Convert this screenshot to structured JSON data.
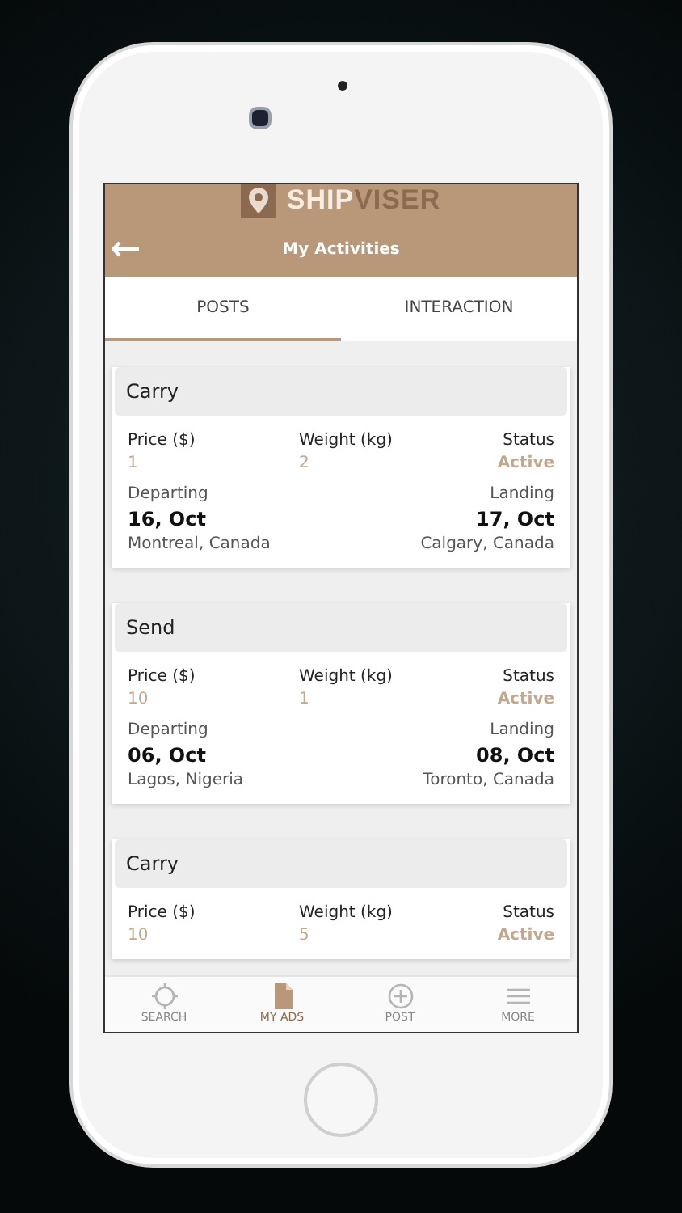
{
  "logo": {
    "parts": [
      "SHIP",
      "VISER"
    ]
  },
  "header": {
    "title": "My Activities"
  },
  "tabs": [
    {
      "label": "POSTS",
      "selected": true
    },
    {
      "label": "INTERACTION",
      "selected": false
    }
  ],
  "posts": [
    {
      "type": "Carry",
      "price_label": "Price ($)",
      "price": "1",
      "weight_label": "Weight (kg)",
      "weight": "2",
      "status_label": "Status",
      "status": "Active",
      "departing_label": "Departing",
      "departing_date": "16, Oct",
      "from": "Montreal, Canada",
      "landing_label": "Landing",
      "landing_date": "17, Oct",
      "to": "Calgary, Canada"
    },
    {
      "type": "Send",
      "price_label": "Price ($)",
      "price": "10",
      "weight_label": "Weight (kg)",
      "weight": "1",
      "status_label": "Status",
      "status": "Active",
      "departing_label": "Departing",
      "departing_date": "06, Oct",
      "from": "Lagos, Nigeria",
      "landing_label": "Landing",
      "landing_date": "08, Oct",
      "to": "Toronto, Canada"
    },
    {
      "type": "Carry",
      "price_label": "Price ($)",
      "price": "10",
      "weight_label": "Weight (kg)",
      "weight": "5",
      "status_label": "Status",
      "status": "Active"
    }
  ],
  "nav": [
    {
      "kind": "search",
      "label": "SEARCH",
      "selected": false
    },
    {
      "kind": "ads",
      "label": "MY ADS",
      "selected": true
    },
    {
      "kind": "post",
      "label": "POST",
      "selected": false
    },
    {
      "kind": "more",
      "label": "MORE",
      "selected": false
    }
  ]
}
